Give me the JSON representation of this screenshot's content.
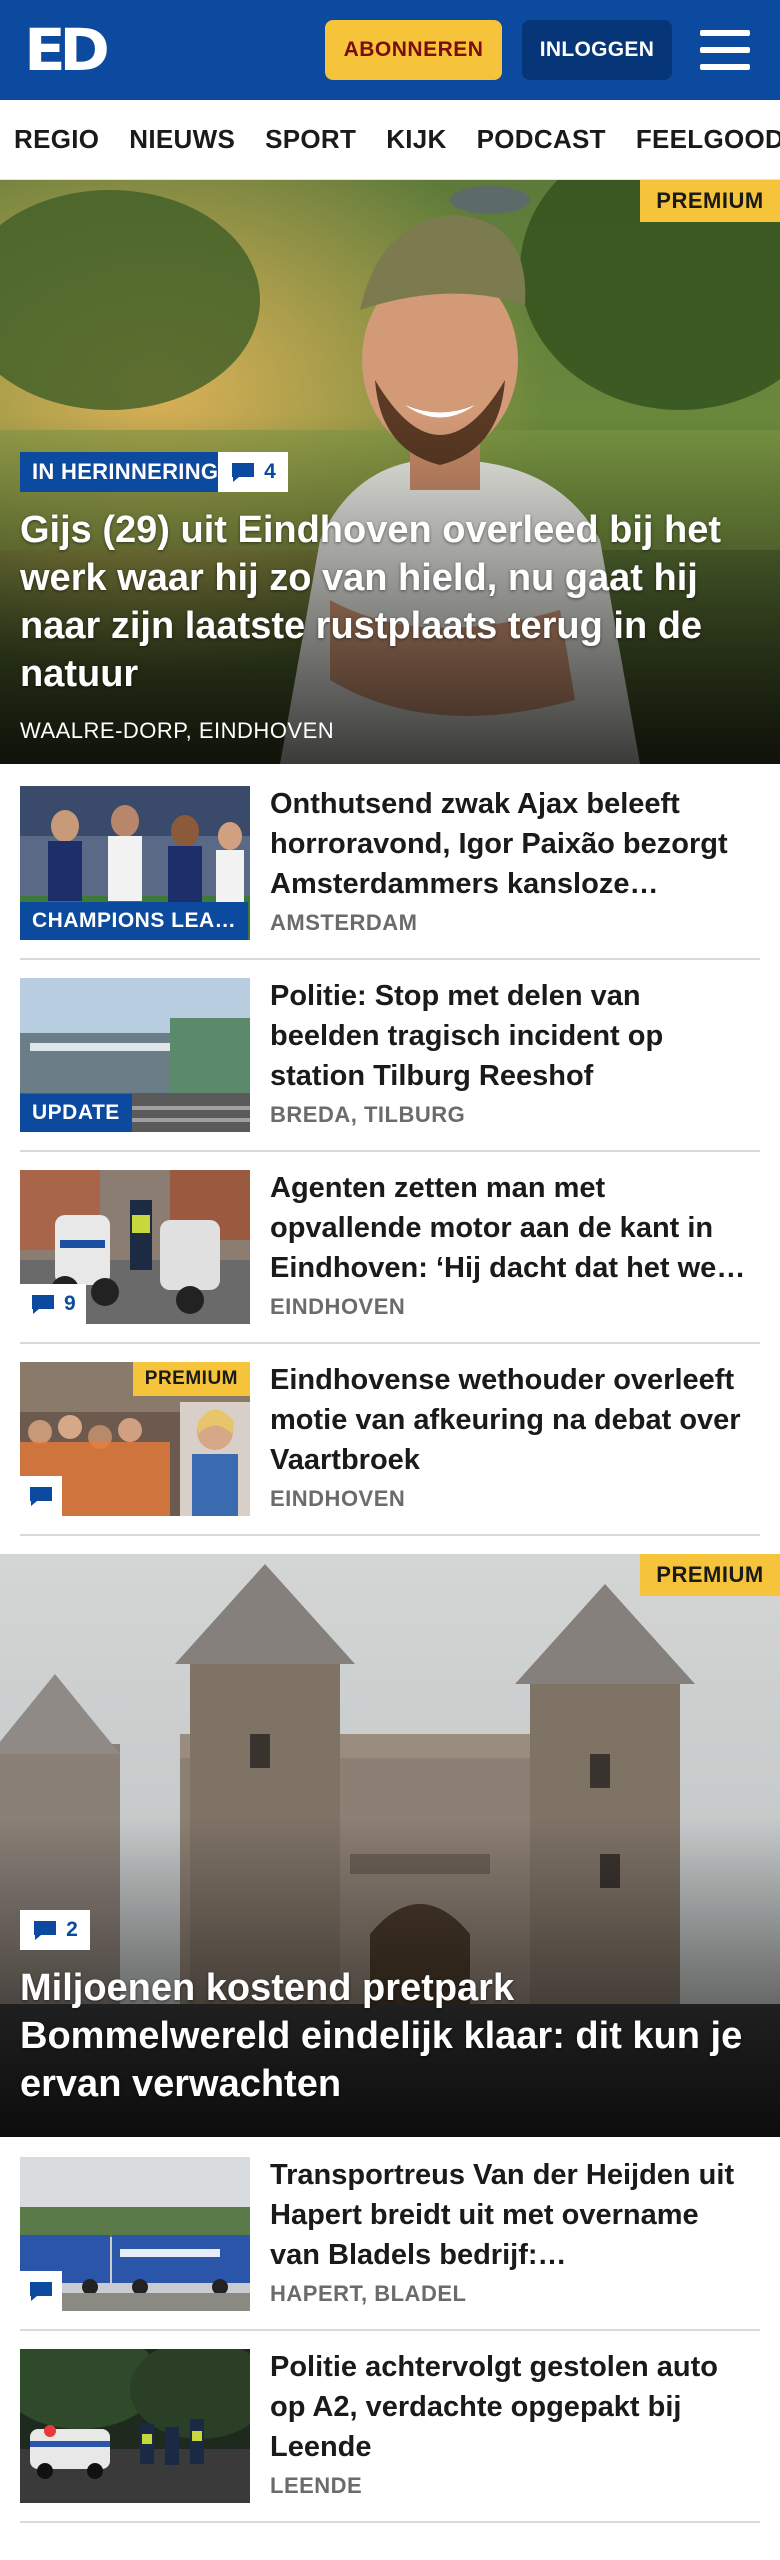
{
  "header": {
    "logo_text": "ED",
    "subscribe_label": "ABONNEREN",
    "login_label": "INLOGGEN",
    "colors": {
      "brand": "#0b4a9e",
      "accent": "#f6c43a",
      "subscribe_text": "#7a0d0d"
    }
  },
  "nav": {
    "items": [
      "REGIO",
      "NIEUWS",
      "SPORT",
      "KIJK",
      "PODCAST",
      "FEELGOOD"
    ]
  },
  "hero1": {
    "premium": "PREMIUM",
    "tag": "IN HERINNERING",
    "comments": "4",
    "title": "Gijs (29) uit Eindhoven overleed bij het werk waar hij zo van hield, nu gaat hij naar zijn laatste rustplaats terug in de natuur",
    "location": "WAALRE-DORP, EINDHOVEN"
  },
  "list1": [
    {
      "title": "Onthutsend zwak Ajax beleeft horroravond, Igor Paixão bezorgt Amsterdammers kansloze…",
      "location": "AMSTERDAM",
      "tag": "CHAMPIONS LEA…",
      "icon": "football-players-photo"
    },
    {
      "title": "Politie: Stop met delen van beelden tragisch incident op station Tilburg Reeshof",
      "location": "BREDA, TILBURG",
      "tag": "UPDATE",
      "icon": "train-station-photo"
    },
    {
      "title": "Agenten zetten man met opvallende motor aan de kant in Eindhoven: ‘Hij dacht dat het we…",
      "location": "EINDHOVEN",
      "comments": "9",
      "icon": "police-motorcycle-photo"
    },
    {
      "title": "Eindhovense wethouder overleeft motie van afkeuring na debat over Vaartbroek",
      "location": "EINDHOVEN",
      "premium": "PREMIUM",
      "comments": "",
      "icon": "council-meeting-photo"
    }
  ],
  "hero2": {
    "premium": "PREMIUM",
    "comments": "2",
    "title": "Miljoenen kostend pretpark Bommelwereld eindelijk klaar: dit kun je ervan verwachten"
  },
  "list2": [
    {
      "title": "Transportreus Van der Heijden uit Hapert breidt uit met overname van Bladels bedrijf:…",
      "location": "HAPERT, BLADEL",
      "comments": "",
      "icon": "trucks-photo"
    },
    {
      "title": "Politie achtervolgt gestolen auto op A2, verdachte opgepakt bij Leende",
      "location": "LEENDE",
      "icon": "police-car-night-photo"
    }
  ]
}
